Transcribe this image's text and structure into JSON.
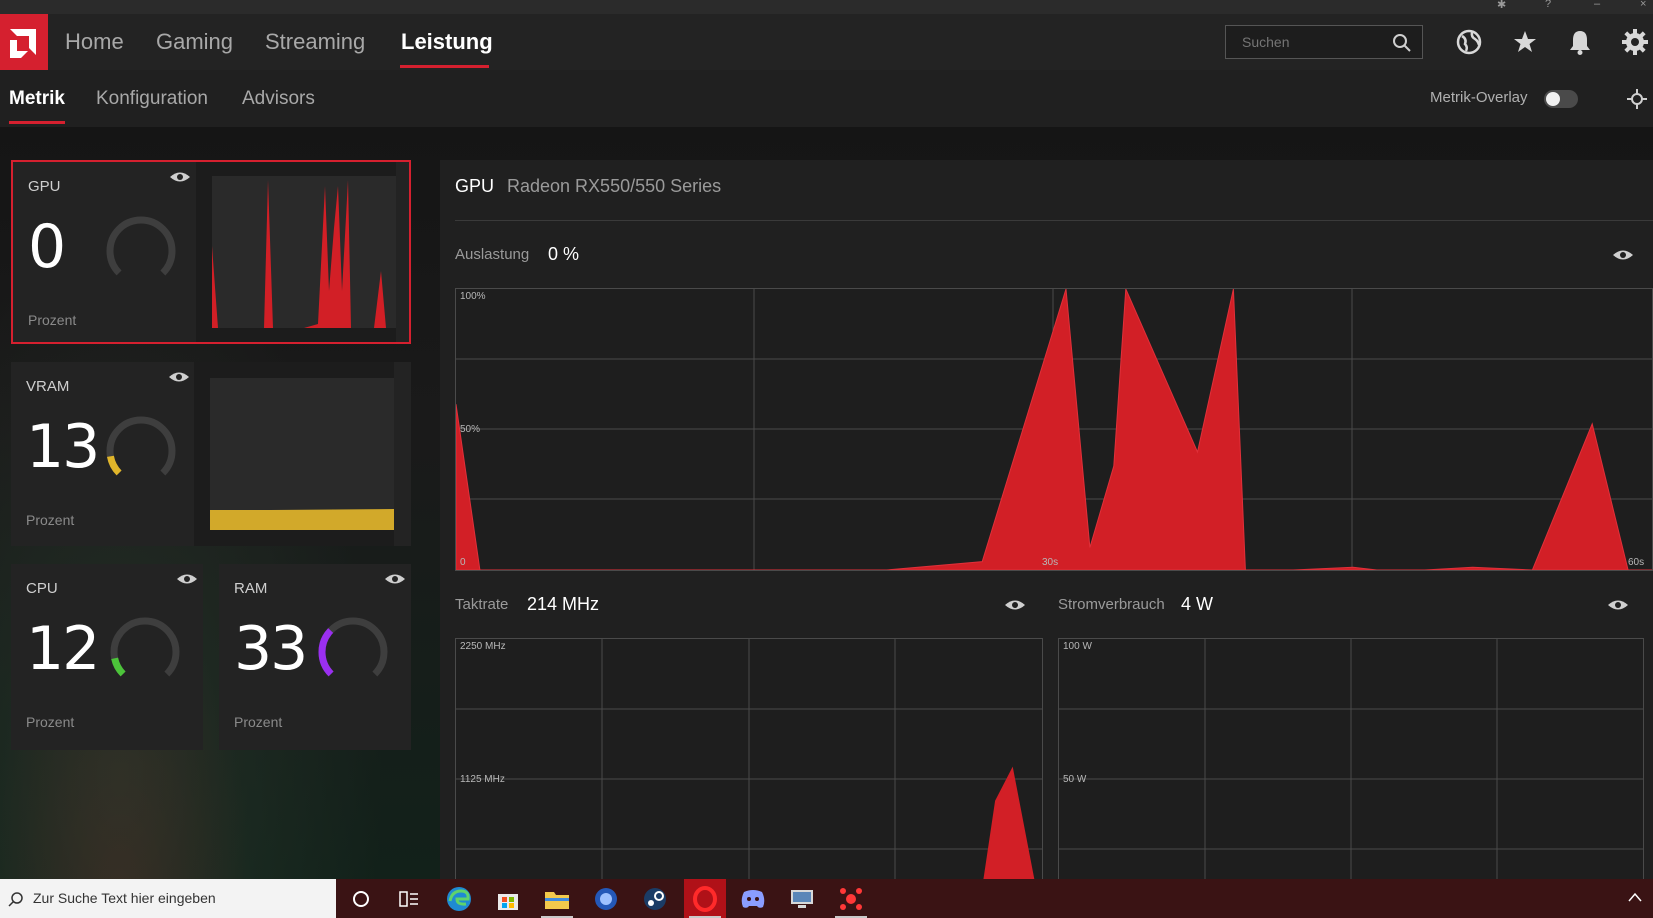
{
  "header": {
    "nav": [
      "Home",
      "Gaming",
      "Streaming",
      "Leistung"
    ],
    "search_placeholder": "Suchen"
  },
  "subnav": {
    "tabs": [
      "Metrik",
      "Konfiguration",
      "Advisors"
    ],
    "overlay_label": "Metrik-Overlay"
  },
  "cards": {
    "gpu": {
      "label": "GPU",
      "value": "0",
      "unit": "Prozent",
      "accent": "#d5202f"
    },
    "vram": {
      "label": "VRAM",
      "value": "13",
      "unit": "Prozent",
      "accent": "#e0b52a"
    },
    "cpu": {
      "label": "CPU",
      "value": "12",
      "unit": "Prozent",
      "accent": "#4cc43a"
    },
    "ram": {
      "label": "RAM",
      "value": "33",
      "unit": "Prozent",
      "accent": "#9a2ff0"
    }
  },
  "panel": {
    "device_label": "GPU",
    "device_name": "Radeon RX550/550 Series",
    "util_label": "Auslastung",
    "util_value": "0 %",
    "clock_label": "Taktrate",
    "clock_value": "214 MHz",
    "power_label": "Stromverbrauch",
    "power_value": "4 W"
  },
  "chart_data": [
    {
      "type": "area",
      "ylabels": [
        "100%",
        "50%",
        "0"
      ],
      "xlabels": [
        "30s",
        "60s"
      ],
      "ylim": [
        0,
        100
      ],
      "xlim": [
        0,
        60
      ],
      "x": [
        0,
        2,
        11,
        18,
        20,
        33,
        36,
        44,
        51,
        53,
        55,
        56,
        62,
        65,
        66,
        70,
        75,
        77,
        81,
        85,
        90,
        95,
        98,
        100
      ],
      "values": [
        59,
        0,
        0,
        0,
        0,
        0,
        0,
        3,
        100,
        8,
        37,
        100,
        42,
        100,
        0,
        0,
        1,
        0,
        0,
        1,
        0,
        52,
        0,
        0
      ],
      "color": "#d21f26"
    },
    {
      "type": "area",
      "ylabels": [
        "2250 MHz",
        "1125 MHz"
      ],
      "ylim": [
        0,
        2250
      ],
      "x": [
        0,
        89,
        92,
        95,
        100
      ],
      "values": [
        0,
        0,
        950,
        1225,
        0
      ],
      "color": "#d21f26"
    },
    {
      "type": "area",
      "ylabels": [
        "100 W",
        "50 W"
      ],
      "ylim": [
        0,
        100
      ],
      "series": [],
      "color": "#d21f26"
    }
  ],
  "taskbar": {
    "search_text": "Zur Suche Text hier eingeben"
  }
}
